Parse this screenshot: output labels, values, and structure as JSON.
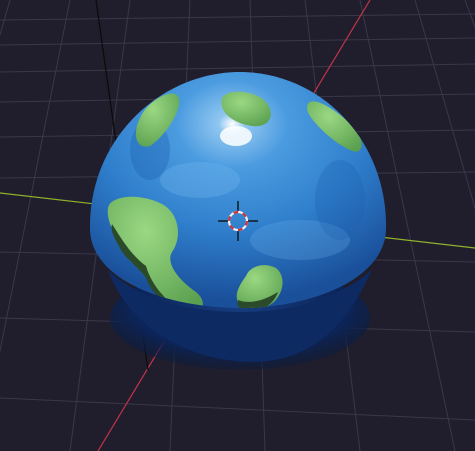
{
  "viewport": {
    "background_color": "#201e2d",
    "grid_color": "#3a3848",
    "grid_major_color": "#4a4858",
    "axis_x_color": "#8fb22a",
    "axis_y_color": "#c2344a",
    "axis_z_color": "#0a0a0a"
  },
  "object": {
    "ocean_color": "#2f7fcc",
    "ocean_highlight_color": "#5aa8e6",
    "shadow_color": "#0f2f6a",
    "land_color": "#7fc06a",
    "land_shadow_color": "#2b4a2a"
  },
  "cursor": {
    "icon": "3d-cursor-icon",
    "ring_color_a": "#d0303a",
    "ring_color_b": "#f2f2f2"
  }
}
